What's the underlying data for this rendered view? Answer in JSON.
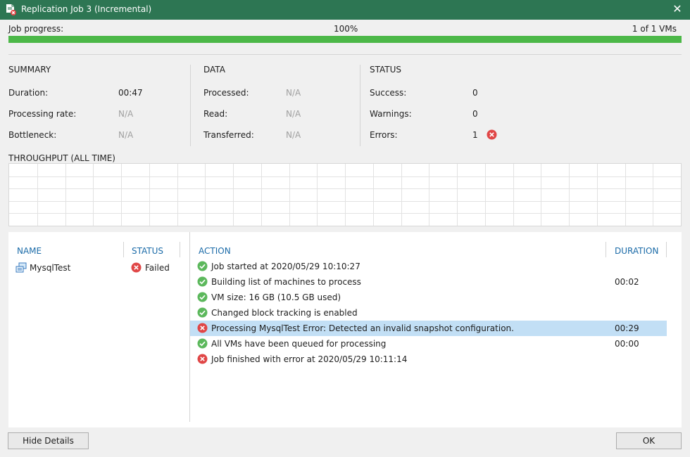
{
  "window": {
    "title": "Replication Job 3 (Incremental)",
    "close_glyph": "✕"
  },
  "progress": {
    "label": "Job progress:",
    "percent_text": "100%",
    "count_text": "1 of 1 VMs",
    "fraction": 1.0,
    "color": "#4cb848"
  },
  "summary": {
    "title": "SUMMARY",
    "duration_label": "Duration:",
    "duration_value": "00:47",
    "rate_label": "Processing rate:",
    "rate_value": "N/A",
    "bottleneck_label": "Bottleneck:",
    "bottleneck_value": "N/A"
  },
  "data_section": {
    "title": "DATA",
    "processed_label": "Processed:",
    "processed_value": "N/A",
    "read_label": "Read:",
    "read_value": "N/A",
    "transferred_label": "Transferred:",
    "transferred_value": "N/A"
  },
  "status_section": {
    "title": "STATUS",
    "success_label": "Success:",
    "success_value": "0",
    "warnings_label": "Warnings:",
    "warnings_value": "0",
    "errors_label": "Errors:",
    "errors_value": "1"
  },
  "throughput": {
    "title": "THROUGHPUT (ALL TIME)"
  },
  "vm_list": {
    "headers": {
      "name": "NAME",
      "status": "STATUS"
    },
    "rows": [
      {
        "name": "MysqlTest",
        "status": "Failed",
        "status_icon": "error-icon"
      }
    ]
  },
  "log": {
    "headers": {
      "action": "ACTION",
      "duration": "DURATION"
    },
    "rows": [
      {
        "icon": "success-icon",
        "text": "Job started at 2020/05/29 10:10:27",
        "duration": ""
      },
      {
        "icon": "success-icon",
        "text": "Building list of machines to process",
        "duration": "00:02"
      },
      {
        "icon": "success-icon",
        "text": "VM size: 16 GB (10.5 GB used)",
        "duration": ""
      },
      {
        "icon": "success-icon",
        "text": "Changed block tracking is enabled",
        "duration": ""
      },
      {
        "icon": "error-icon",
        "text": "Processing MysqlTest Error: Detected an invalid snapshot configuration.",
        "duration": "00:29",
        "selected": true
      },
      {
        "icon": "success-icon",
        "text": "All VMs have been queued for processing",
        "duration": "00:00"
      },
      {
        "icon": "error-icon",
        "text": "Job finished with error at 2020/05/29 10:11:14",
        "duration": ""
      }
    ]
  },
  "buttons": {
    "hide_details": "Hide Details",
    "ok": "OK"
  },
  "colors": {
    "titlebar": "#2d7653",
    "success": "#5cb85c",
    "error": "#e04646",
    "header_text": "#1b6ba8",
    "selection": "#c2dff5"
  }
}
